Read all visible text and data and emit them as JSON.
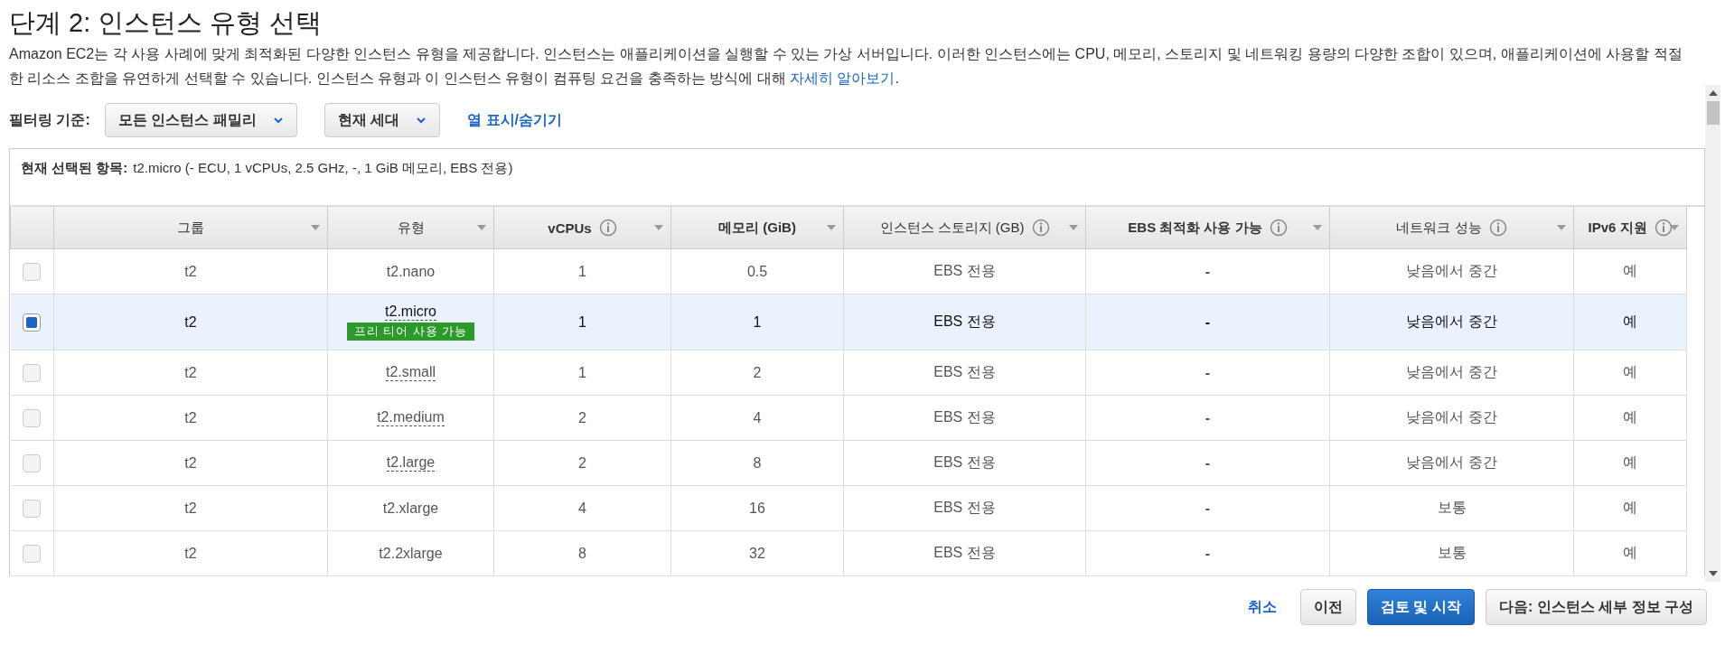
{
  "title": "단계 2: 인스턴스 유형 선택",
  "description": {
    "text": "Amazon EC2는 각 사용 사례에 맞게 최적화된 다양한 인스턴스 유형을 제공합니다. 인스턴스는 애플리케이션을 실행할 수 있는 가상 서버입니다. 이러한 인스턴스에는 CPU, 메모리, 스토리지 및 네트워킹 용량의 다양한 조합이 있으며, 애플리케이션에 사용할 적절한 리소스 조합을 유연하게 선택할 수 있습니다. 인스턴스 유형과 이 인스턴스 유형이 컴퓨팅 요건을 충족하는 방식에 대해 ",
    "link": "자세히 알아보기",
    "end": "."
  },
  "filter": {
    "label": "필터링 기준:",
    "dropdowns": [
      {
        "value": "모든 인스턴스 패밀리"
      },
      {
        "value": "현재 세대"
      }
    ],
    "link": "열 표시/숨기기"
  },
  "current_selection": {
    "label": "현재 선택된 항목:",
    "value": "t2.micro (- ECU, 1 vCPUs, 2.5 GHz, -, 1 GiB 메모리, EBS 전용)"
  },
  "table": {
    "columns": [
      {
        "label": "그룹",
        "info": false,
        "bold": false
      },
      {
        "label": "유형",
        "info": false,
        "bold": false
      },
      {
        "label": "vCPUs",
        "info": true,
        "bold": true
      },
      {
        "label": "메모리 (GiB)",
        "info": false,
        "bold": true
      },
      {
        "label": "인스턴스 스토리지 (GB)",
        "info": true,
        "bold": false
      },
      {
        "label": "EBS 최적화 사용 가능",
        "info": true,
        "bold": true
      },
      {
        "label": "네트워크 성능",
        "info": true,
        "bold": false
      },
      {
        "label": "IPv6 지원",
        "info": true,
        "bold": true
      }
    ],
    "rows": [
      {
        "selected": false,
        "tooltip": false,
        "cells": [
          "t2",
          "t2.nano",
          "1",
          "0.5",
          "EBS 전용",
          "-",
          "낮음에서 중간",
          "예"
        ]
      },
      {
        "selected": true,
        "tooltip": true,
        "badge": "프리 티어 사용 가능",
        "cells": [
          "t2",
          "t2.micro",
          "1",
          "1",
          "EBS 전용",
          "-",
          "낮음에서 중간",
          "예"
        ]
      },
      {
        "selected": false,
        "tooltip": true,
        "cells": [
          "t2",
          "t2.small",
          "1",
          "2",
          "EBS 전용",
          "-",
          "낮음에서 중간",
          "예"
        ]
      },
      {
        "selected": false,
        "tooltip": true,
        "cells": [
          "t2",
          "t2.medium",
          "2",
          "4",
          "EBS 전용",
          "-",
          "낮음에서 중간",
          "예"
        ]
      },
      {
        "selected": false,
        "tooltip": true,
        "cells": [
          "t2",
          "t2.large",
          "2",
          "8",
          "EBS 전용",
          "-",
          "낮음에서 중간",
          "예"
        ]
      },
      {
        "selected": false,
        "tooltip": false,
        "cells": [
          "t2",
          "t2.xlarge",
          "4",
          "16",
          "EBS 전용",
          "-",
          "보통",
          "예"
        ]
      },
      {
        "selected": false,
        "tooltip": false,
        "cells": [
          "t2",
          "t2.2xlarge",
          "8",
          "32",
          "EBS 전용",
          "-",
          "보통",
          "예"
        ]
      }
    ]
  },
  "buttons": [
    {
      "kind": "link",
      "label": "취소"
    },
    {
      "kind": "default",
      "label": "이전"
    },
    {
      "kind": "primary",
      "label": "검토 및 시작"
    },
    {
      "kind": "default",
      "label": "다음: 인스턴스 세부 정보 구성"
    }
  ]
}
